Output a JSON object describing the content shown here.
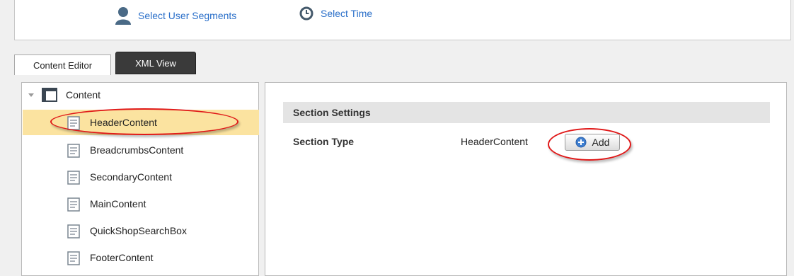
{
  "toolbar": {
    "select_user_segments": "Select User Segments",
    "select_time": "Select Time"
  },
  "tabs": [
    {
      "label": "Content Editor",
      "active": true
    },
    {
      "label": "XML View",
      "active": false
    }
  ],
  "tree": {
    "root_label": "Content",
    "items": [
      {
        "label": "HeaderContent",
        "selected": true
      },
      {
        "label": "BreadcrumbsContent",
        "selected": false
      },
      {
        "label": "SecondaryContent",
        "selected": false
      },
      {
        "label": "MainContent",
        "selected": false
      },
      {
        "label": "QuickShopSearchBox",
        "selected": false
      },
      {
        "label": "FooterContent",
        "selected": false
      }
    ]
  },
  "editor": {
    "section_title": "Section Settings",
    "section_type_label": "Section Type",
    "section_type_value": "HeaderContent",
    "add_button_label": "Add"
  },
  "colors": {
    "link": "#2a6fc9",
    "highlight_ring": "#e01818",
    "selected_row": "#fbe3a0",
    "xml_tab_bg": "#3a3a3a"
  }
}
